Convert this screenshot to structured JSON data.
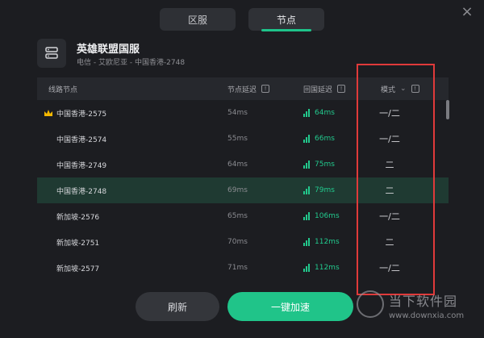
{
  "tabs": [
    {
      "label": "区服"
    },
    {
      "label": "节点"
    }
  ],
  "game": {
    "title": "英雄联盟国服",
    "subtitle": "电信 - 艾欧尼亚 - 中国香港-2748"
  },
  "table": {
    "headers": {
      "name": "线路节点",
      "node_delay": "节点延迟",
      "return_delay": "回国延迟",
      "mode": "模式"
    },
    "rows": [
      {
        "name": "中国香港-2575",
        "node_delay": "54ms",
        "return_delay": "64ms",
        "mode": "一/二",
        "crown": true
      },
      {
        "name": "中国香港-2574",
        "node_delay": "55ms",
        "return_delay": "66ms",
        "mode": "一/二"
      },
      {
        "name": "中国香港-2749",
        "node_delay": "64ms",
        "return_delay": "75ms",
        "mode": "二"
      },
      {
        "name": "中国香港-2748",
        "node_delay": "69ms",
        "return_delay": "79ms",
        "mode": "二",
        "selected": true
      },
      {
        "name": "新加坡-2576",
        "node_delay": "65ms",
        "return_delay": "106ms",
        "mode": "一/二"
      },
      {
        "name": "新加坡-2751",
        "node_delay": "70ms",
        "return_delay": "112ms",
        "mode": "二"
      },
      {
        "name": "新加坡-2577",
        "node_delay": "71ms",
        "return_delay": "112ms",
        "mode": "一/二"
      }
    ]
  },
  "buttons": {
    "refresh": "刷新",
    "boost": "一键加速"
  },
  "watermark": {
    "brand": "当下软件园",
    "url": "www.downxia.com"
  },
  "colors": {
    "accent": "#20c489",
    "highlight": "#e03a3a",
    "background": "#1c1d21"
  }
}
